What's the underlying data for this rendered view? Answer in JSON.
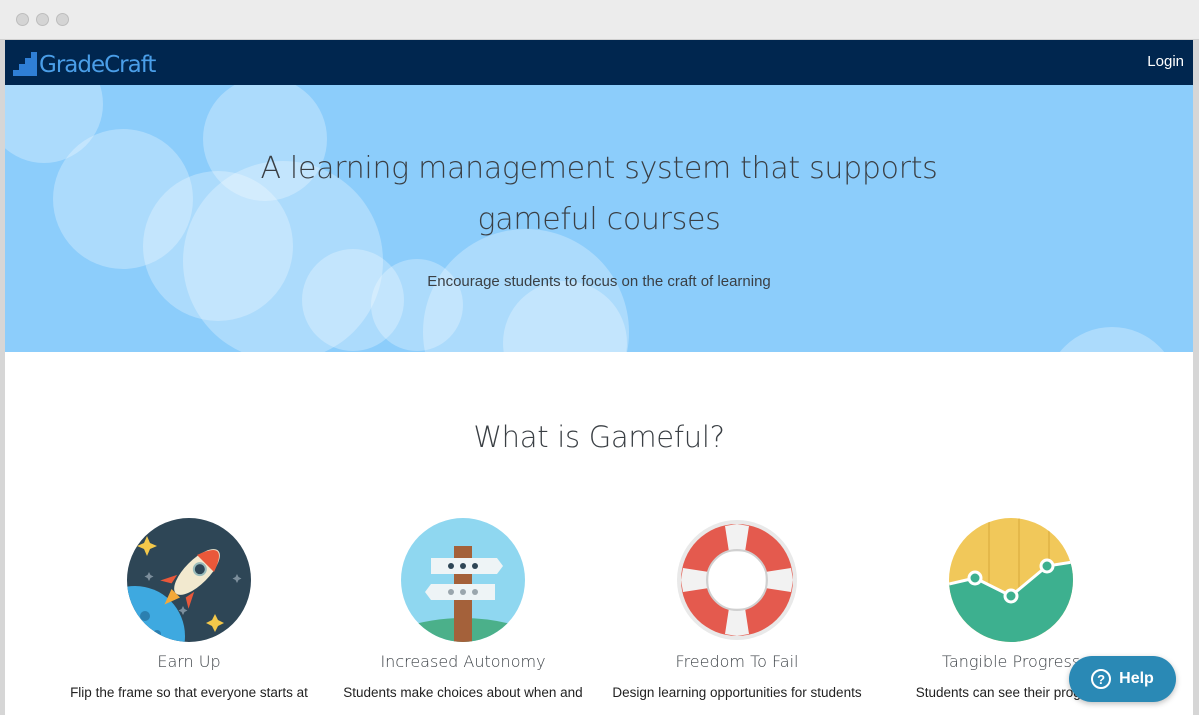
{
  "nav": {
    "logo_text": "GradeCraft",
    "login_label": "Login"
  },
  "hero": {
    "title": "A learning management system that supports gameful courses",
    "subtitle": "Encourage students to focus on the craft of learning"
  },
  "section": {
    "title": "What is Gameful?"
  },
  "features": [
    {
      "title": "Earn Up",
      "icon": "rocket-icon",
      "description": "Flip the frame so that everyone starts at"
    },
    {
      "title": "Increased Autonomy",
      "icon": "signpost-icon",
      "description": "Students make choices about when and"
    },
    {
      "title": "Freedom To Fail",
      "icon": "lifebuoy-icon",
      "description": "Design learning opportunities for students"
    },
    {
      "title": "Tangible Progress",
      "icon": "chart-icon",
      "description": "Students can see their progress"
    }
  ],
  "help": {
    "label": "Help"
  },
  "colors": {
    "navbar": "#00264f",
    "hero": "#8ccdfb",
    "help": "#2a89b5"
  }
}
